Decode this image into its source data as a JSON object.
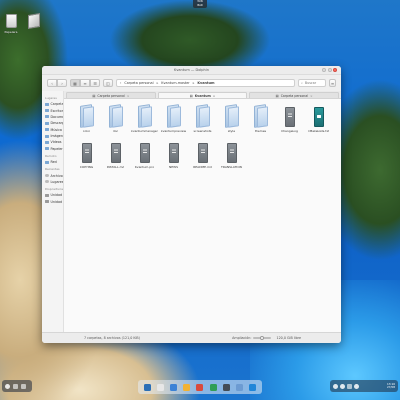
{
  "desktop": {
    "trash_label": "Papelera",
    "topnotch_text": "WIN\nBAR"
  },
  "window": {
    "title": "Kvantum — Dolphin"
  },
  "toolbar": {
    "breadcrumb": [
      "Carpeta personal",
      "Kvantum-master",
      "Kvantum"
    ],
    "search_placeholder": "Buscar"
  },
  "sidebar": {
    "sections": [
      {
        "title": "Lugares",
        "items": [
          "Carpeta personal",
          "Escritorio",
          "Documentos",
          "Descargas",
          "Música",
          "Imágenes",
          "Vídeos",
          "Papelera"
        ]
      },
      {
        "title": "Remoto",
        "items": [
          "Red"
        ]
      },
      {
        "title": "Recientes",
        "items": [
          "Archivos recientes",
          "Lugares recientes"
        ]
      },
      {
        "title": "Dispositivos",
        "items": [
          "Unidad interna de 380...",
          "Unidad interna de 180..."
        ]
      }
    ]
  },
  "tabs": [
    {
      "label": "Carpeta personal",
      "active": false
    },
    {
      "label": "Kvantum",
      "active": true
    },
    {
      "label": "Carpeta personal",
      "active": false
    }
  ],
  "files": [
    {
      "name": "color",
      "type": "folder"
    },
    {
      "name": "doc",
      "type": "folder"
    },
    {
      "name": "kvantummanager",
      "type": "folder"
    },
    {
      "name": "kvantumpreview",
      "type": "folder"
    },
    {
      "name": "screenshots",
      "type": "folder"
    },
    {
      "name": "style",
      "type": "folder"
    },
    {
      "name": "themes",
      "type": "folder"
    },
    {
      "name": "ChangeLog",
      "type": "doc"
    },
    {
      "name": "CMakeLists.txt",
      "type": "doc-teal"
    },
    {
      "name": "COPYING",
      "type": "doc"
    },
    {
      "name": "INSTALL.md",
      "type": "doc"
    },
    {
      "name": "Kvantum.pro",
      "type": "doc"
    },
    {
      "name": "NEWS",
      "type": "doc"
    },
    {
      "name": "README.md",
      "type": "doc"
    },
    {
      "name": "TRANSLATION",
      "type": "doc"
    }
  ],
  "status": {
    "summary": "7 carpetas, 8 archivos (121,0 KiB)",
    "zoom_label": "Ampliación:",
    "zoom_level": 0.35,
    "free_space": "120,0 GiB libre"
  },
  "dock": {
    "colors": [
      "#2b6fb6",
      "#e7e7e7",
      "#3b82d6",
      "#f2b233",
      "#d94a3d",
      "#2f9e57",
      "#444b55",
      "#6c9bd2",
      "#1f86d8"
    ]
  },
  "panel_right": {
    "clock": "13:16\n27/08"
  }
}
